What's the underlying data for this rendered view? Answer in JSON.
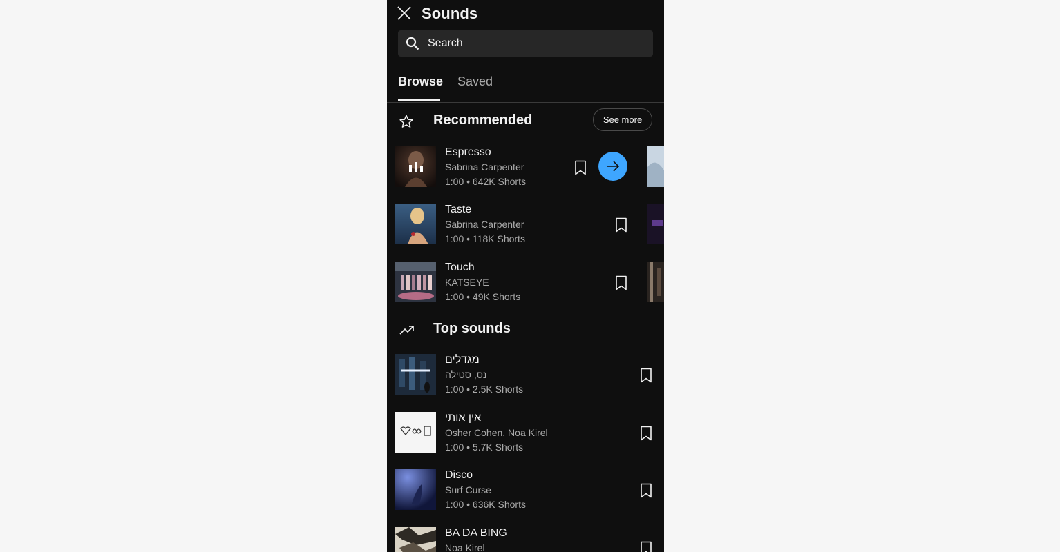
{
  "header": {
    "title": "Sounds",
    "close_icon": "close-icon"
  },
  "search": {
    "placeholder": "Search",
    "icon": "search-icon"
  },
  "tabs": [
    {
      "label": "Browse",
      "active": true
    },
    {
      "label": "Saved",
      "active": false
    }
  ],
  "recommended": {
    "title": "Recommended",
    "icon": "star-outline-icon",
    "see_more_label": "See more",
    "items": [
      {
        "title": "Espresso",
        "artist": "Sabrina Carpenter",
        "meta": "1:00 • 642K Shorts",
        "playing": true
      },
      {
        "title": "Taste",
        "artist": "Sabrina Carpenter",
        "meta": "1:00 • 118K Shorts",
        "playing": false
      },
      {
        "title": "Touch",
        "artist": "KATSEYE",
        "meta": "1:00 • 49K Shorts",
        "playing": false
      }
    ]
  },
  "top_sounds": {
    "title": "Top sounds",
    "icon": "trending-up-icon",
    "items": [
      {
        "title": "מגדלים",
        "artist": "נס, סטילה",
        "meta": "1:00 • 2.5K Shorts"
      },
      {
        "title": "אין אותי",
        "artist": "Osher Cohen, Noa Kirel",
        "meta": "1:00 • 5.7K Shorts"
      },
      {
        "title": "Disco",
        "artist": "Surf Curse",
        "meta": "1:00 • 636K Shorts"
      },
      {
        "title": "BA DA BING",
        "artist": "Noa Kirel",
        "meta": ""
      }
    ]
  },
  "colors": {
    "background": "#0f0f0f",
    "accent": "#3ea6ff",
    "text_primary": "#f1f1f1",
    "text_secondary": "#aaaaaa",
    "search_bg": "#272727"
  }
}
